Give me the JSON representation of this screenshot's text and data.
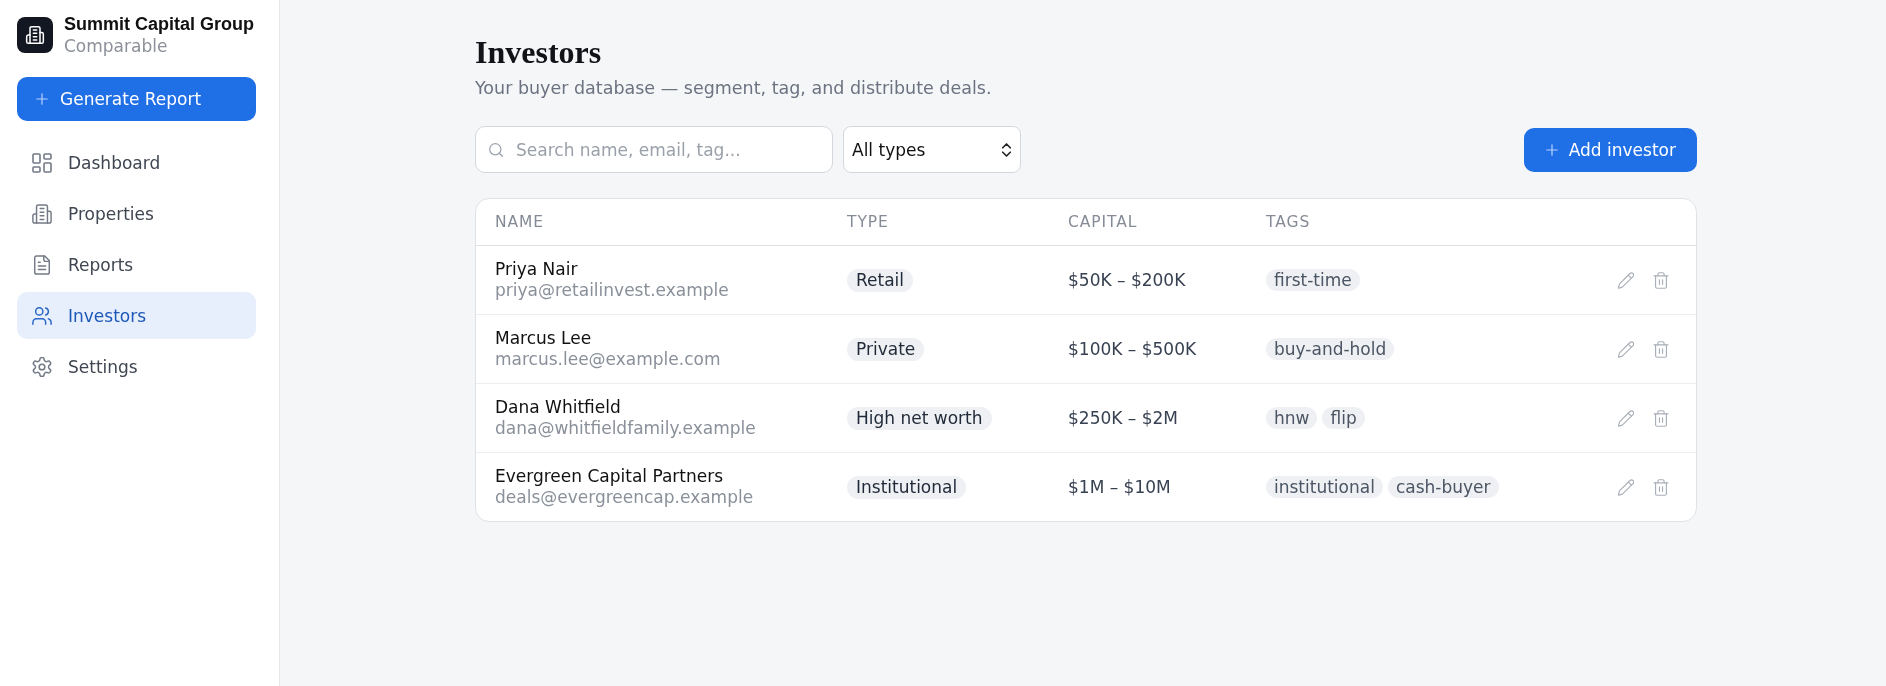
{
  "sidebar": {
    "brand": {
      "name": "Summit Capital Group",
      "subtitle": "Comparable"
    },
    "generate_button": {
      "label": "Generate Report"
    },
    "items": [
      {
        "label": "Dashboard",
        "selected": false
      },
      {
        "label": "Properties",
        "selected": false
      },
      {
        "label": "Reports",
        "selected": false
      },
      {
        "label": "Investors",
        "selected": true
      },
      {
        "label": "Settings",
        "selected": false
      }
    ]
  },
  "header": {
    "title": "Investors",
    "subtitle": "Your buyer database — segment, tag, and distribute deals."
  },
  "toolbar": {
    "search": {
      "placeholder": "Search name, email, tag..."
    },
    "type_filter": {
      "value": "All types"
    },
    "add_button": {
      "label": "Add investor"
    }
  },
  "table": {
    "columns": [
      "NAME",
      "TYPE",
      "CAPITAL",
      "TAGS"
    ],
    "rows": [
      {
        "name": "Priya Nair",
        "email": "priya@retailinvest.example",
        "type": "Retail",
        "capital": "$50K – $200K",
        "tags": [
          "first-time"
        ]
      },
      {
        "name": "Marcus Lee",
        "email": "marcus.lee@example.com",
        "type": "Private",
        "capital": "$100K – $500K",
        "tags": [
          "buy-and-hold"
        ]
      },
      {
        "name": "Dana Whitfield",
        "email": "dana@whitfieldfamily.example",
        "type": "High net worth",
        "capital": "$250K – $2M",
        "tags": [
          "hnw",
          "flip"
        ]
      },
      {
        "name": "Evergreen Capital Partners",
        "email": "deals@evergreencap.example",
        "type": "Institutional",
        "capital": "$1M – $10M",
        "tags": [
          "institutional",
          "cash-buyer"
        ]
      }
    ]
  }
}
